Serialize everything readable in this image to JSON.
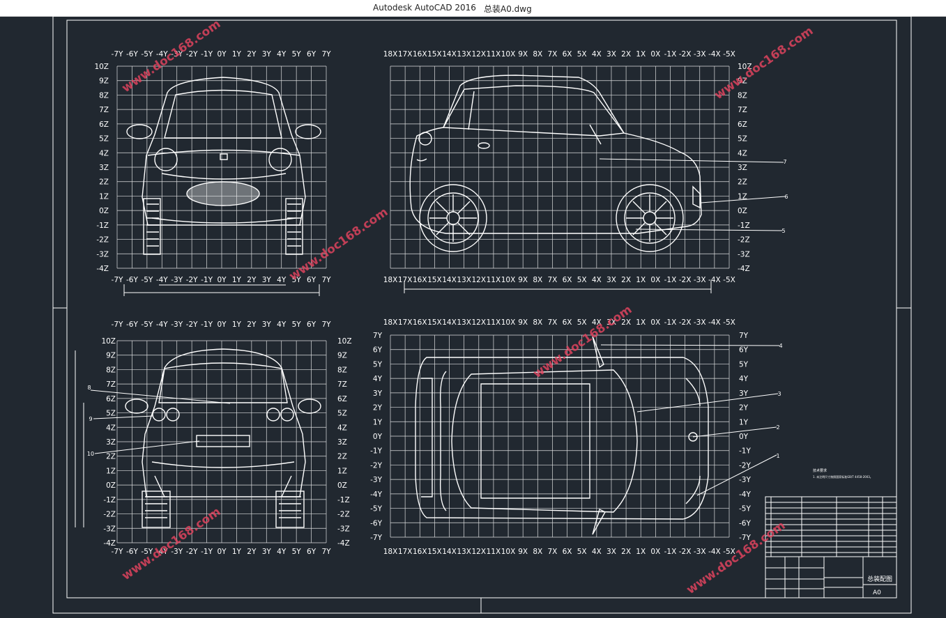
{
  "window": {
    "app_title": "Autodesk AutoCAD 2016",
    "file_name": "总装A0.dwg"
  },
  "drawing": {
    "y_front_labels": [
      "-7Y",
      "-6Y",
      "-5Y",
      "-4Y",
      "-3Y",
      "-2Y",
      "-1Y",
      "0Y",
      "1Y",
      "2Y",
      "3Y",
      "4Y",
      "5Y",
      "6Y",
      "7Y"
    ],
    "z_labels": [
      "10Z",
      "9Z",
      "8Z",
      "7Z",
      "6Z",
      "5Z",
      "4Z",
      "3Z",
      "2Z",
      "1Z",
      "0Z",
      "-1Z",
      "-2Z",
      "-3Z",
      "-4Z"
    ],
    "x_labels": [
      "18X",
      "17X",
      "16X",
      "15X",
      "14X",
      "13X",
      "12X",
      "11X",
      "10X",
      "9X",
      "8X",
      "7X",
      "6X",
      "5X",
      "4X",
      "3X",
      "2X",
      "1X",
      "0X",
      "-1X",
      "-2X",
      "-3X",
      "-4X",
      "-5X"
    ],
    "y_top_labels": [
      "7Y",
      "6Y",
      "5Y",
      "4Y",
      "3Y",
      "2Y",
      "1Y",
      "0Y",
      "-1Y",
      "-2Y",
      "-3Y",
      "-4Y",
      "-5Y",
      "-6Y",
      "-7Y"
    ],
    "callouts": {
      "side": [
        "7",
        "6",
        "5"
      ],
      "top": [
        "4",
        "3",
        "2",
        "1"
      ],
      "rear": [
        "8",
        "9",
        "10"
      ]
    },
    "watermark": "www.doc168.com",
    "title_block": {
      "drawing_name": "总装配图",
      "size": "A0",
      "tech_req_title": "技术要求",
      "tech_req_line": "1. 未注明尺寸按照国家标准GB/T 4458-2003。"
    }
  },
  "colors": {
    "background": "#212830",
    "lines": "#ffffff",
    "watermark": "#e2445f",
    "titlebar": "#ffffff"
  }
}
